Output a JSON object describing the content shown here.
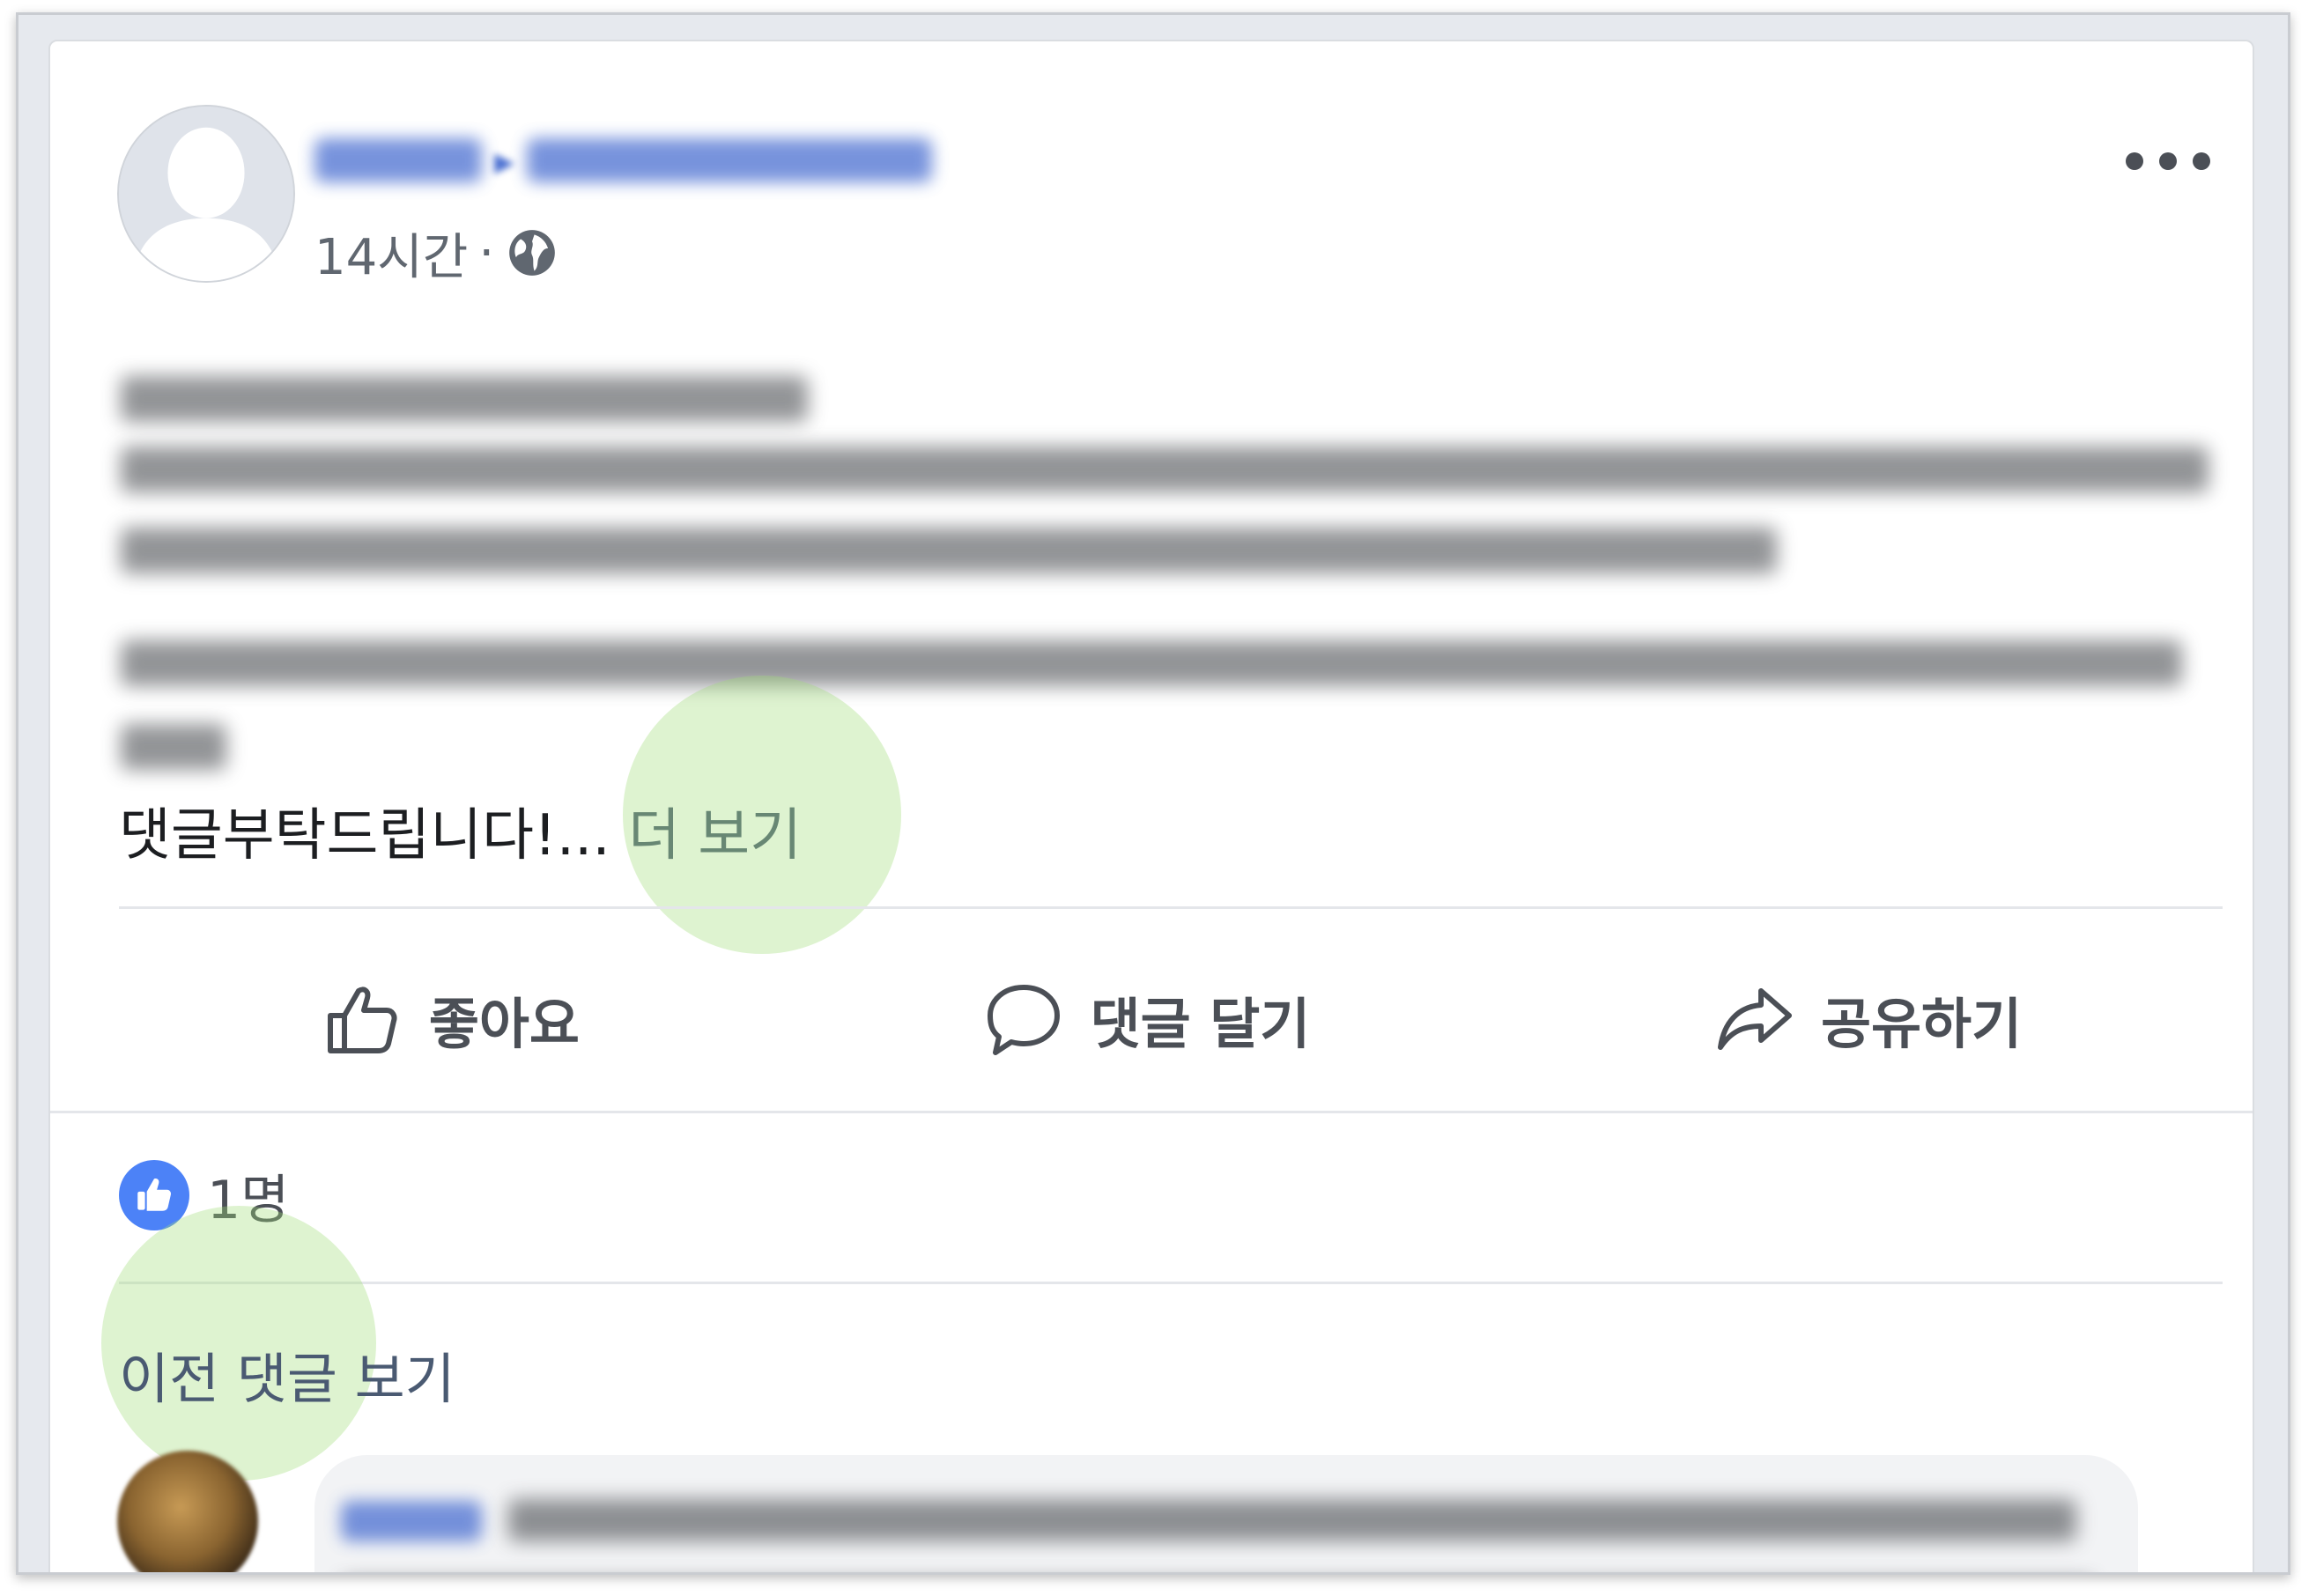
{
  "post": {
    "time": "14시간",
    "separator": "·",
    "visibility_icon": "globe-icon",
    "truncated_text": "댓글부탁드립니다!...",
    "see_more": "더 보기"
  },
  "actions": {
    "like": "좋아요",
    "comment": "댓글 달기",
    "share": "공유하기"
  },
  "reactions": {
    "count": "1명"
  },
  "comments": {
    "view_previous": "이전 댓글 보기"
  },
  "colors": {
    "link_blue": "#4a6fd1",
    "like_blue": "#4c82f7",
    "highlight_green": "#a0dc78"
  }
}
